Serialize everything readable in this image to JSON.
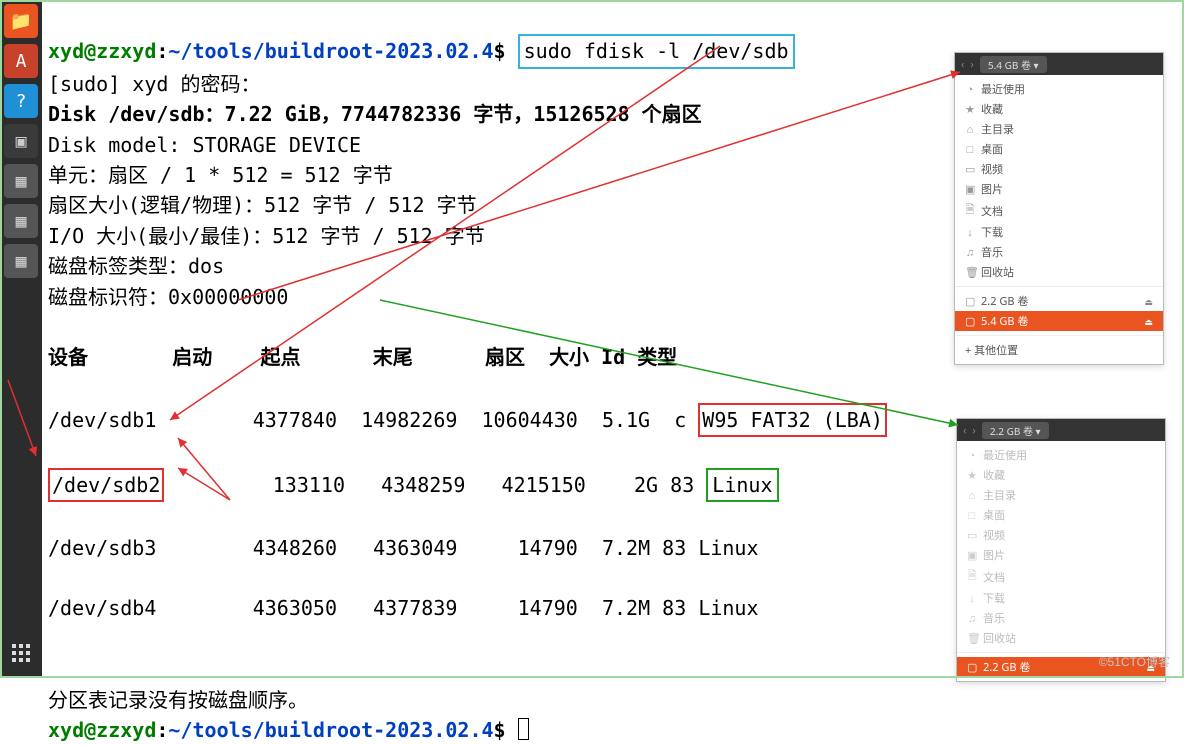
{
  "prompt": {
    "user": "xyd@zzxyd",
    "sep": ":",
    "path": "~/tools/buildroot-2023.02.4",
    "sign": "$",
    "command": "sudo fdisk -l /dev/sdb"
  },
  "sudo_line": "[sudo] xyd 的密码：",
  "disk_line": "Disk /dev/sdb：7.22 GiB，7744782336 字节，15126528 个扇区",
  "model_line": "Disk model: STORAGE DEVICE",
  "unit_line": "单元：扇区 / 1 * 512 = 512 字节",
  "sector_line": "扇区大小(逻辑/物理)：512 字节 / 512 字节",
  "io_line": "I/O 大小(最小/最佳)：512 字节 / 512 字节",
  "label_line": "磁盘标签类型：dos",
  "ident_line": "磁盘标识符：0x00000000",
  "table": {
    "headers": {
      "dev": "设备",
      "boot": "启动",
      "start": "起点",
      "end": "末尾",
      "sectors": "扇区",
      "size": "大小",
      "id": "Id",
      "type": "类型"
    },
    "rows": [
      {
        "dev": "/dev/sdb1",
        "start": "4377840",
        "end": "14982269",
        "sectors": "10604430",
        "size": "5.1G",
        "id": "c",
        "type": "W95 FAT32 (LBA)"
      },
      {
        "dev": "/dev/sdb2",
        "start": "133110",
        "end": "4348259",
        "sectors": "4215150",
        "size": "2G",
        "id": "83",
        "type": "Linux"
      },
      {
        "dev": "/dev/sdb3",
        "start": "4348260",
        "end": "4363049",
        "sectors": "14790",
        "size": "7.2M",
        "id": "83",
        "type": "Linux"
      },
      {
        "dev": "/dev/sdb4",
        "start": "4363050",
        "end": "4377839",
        "sectors": "14790",
        "size": "7.2M",
        "id": "83",
        "type": "Linux"
      }
    ]
  },
  "note_line": "分区表记录没有按磁盘顺序。",
  "fm1": {
    "vol": "5.4 GB 卷",
    "items": [
      {
        "icon": "◔",
        "label": "最近使用"
      },
      {
        "icon": "★",
        "label": "收藏"
      },
      {
        "icon": "⌂",
        "label": "主目录"
      },
      {
        "icon": "□",
        "label": "桌面"
      },
      {
        "icon": "▭",
        "label": "视频"
      },
      {
        "icon": "▣",
        "label": "图片"
      },
      {
        "icon": "🗎",
        "label": "文档"
      },
      {
        "icon": "↓",
        "label": "下载"
      },
      {
        "icon": "♫",
        "label": "音乐"
      },
      {
        "icon": "🗑",
        "label": "回收站"
      }
    ],
    "vol_22": "2.2 GB 卷",
    "vol_54": "5.4 GB 卷",
    "other": "+ 其他位置"
  },
  "fm2": {
    "vol": "2.2 GB 卷",
    "items": [
      {
        "icon": "◔",
        "label": "最近使用"
      },
      {
        "icon": "★",
        "label": "收藏"
      },
      {
        "icon": "⌂",
        "label": "主目录"
      },
      {
        "icon": "□",
        "label": "桌面"
      },
      {
        "icon": "▭",
        "label": "视频"
      },
      {
        "icon": "▣",
        "label": "图片"
      },
      {
        "icon": "🗎",
        "label": "文档"
      },
      {
        "icon": "↓",
        "label": "下载"
      },
      {
        "icon": "♫",
        "label": "音乐"
      },
      {
        "icon": "🗑",
        "label": "回收站"
      }
    ],
    "vol_22": "2.2 GB 卷"
  },
  "watermark": "©51CTO博客"
}
